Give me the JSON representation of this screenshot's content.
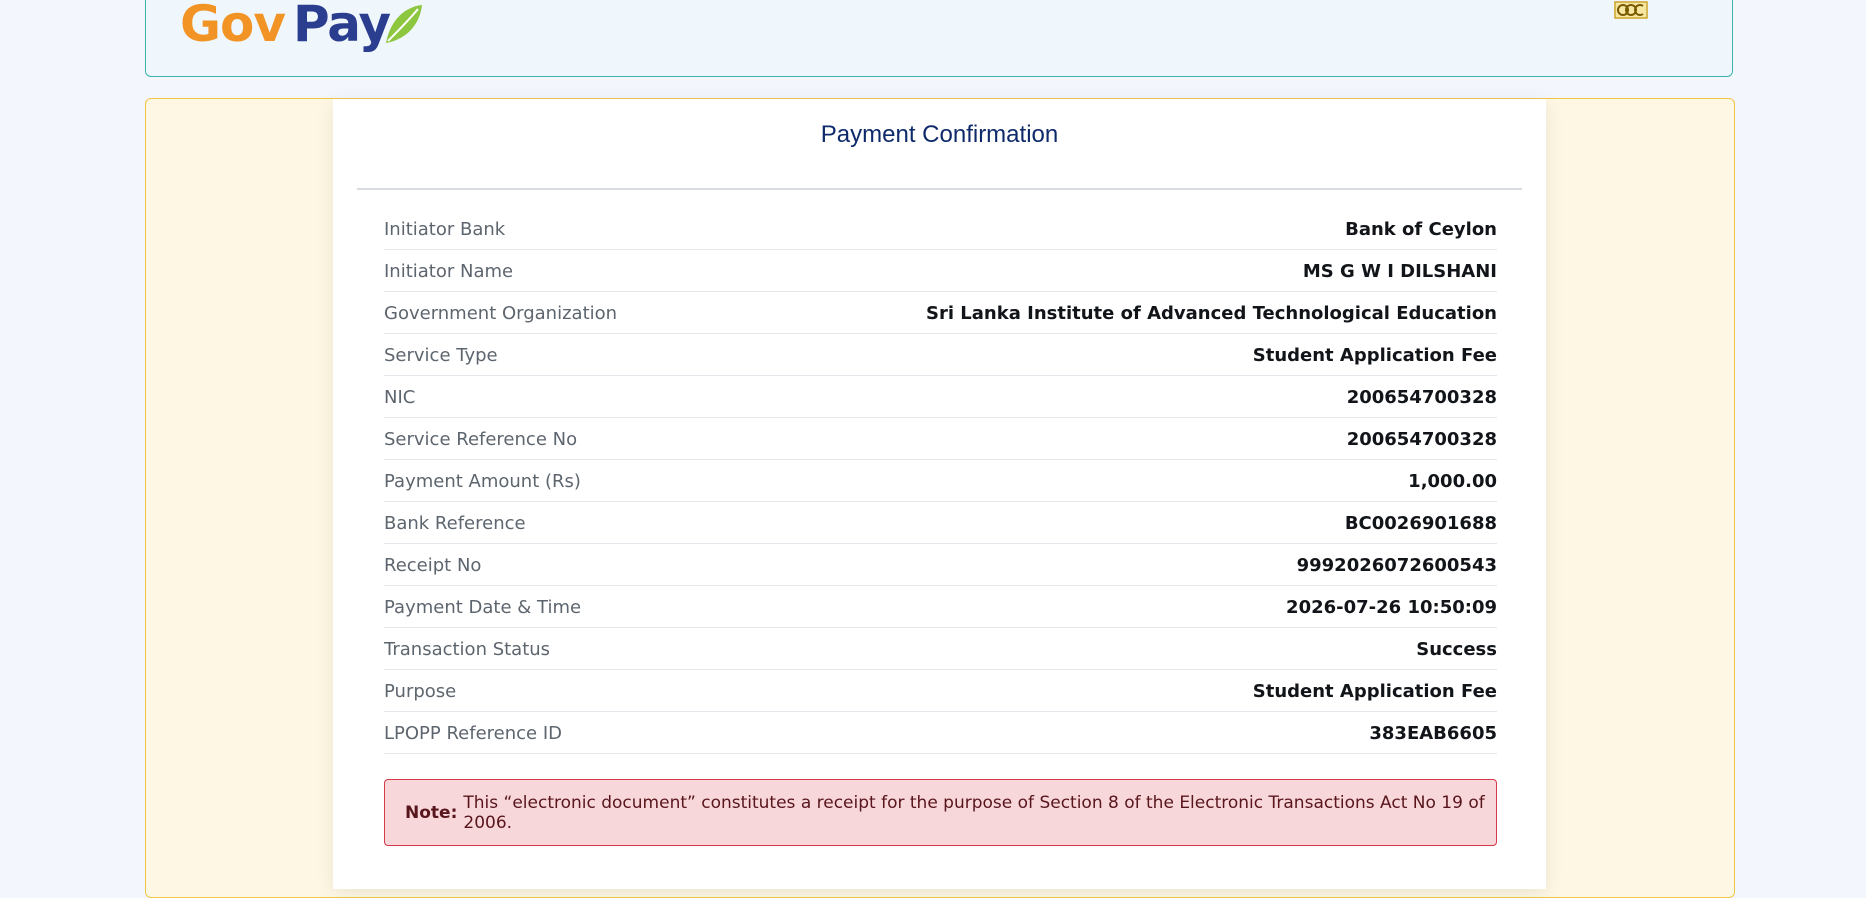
{
  "header": {
    "logo_gov": "Gov",
    "logo_pay": "Pay"
  },
  "card": {
    "title": "Payment Confirmation",
    "rows": [
      {
        "label": "Initiator Bank",
        "value": "Bank of Ceylon"
      },
      {
        "label": "Initiator Name",
        "value": "MS G W I DILSHANI"
      },
      {
        "label": "Government Organization",
        "value": "Sri Lanka Institute of Advanced Technological Education"
      },
      {
        "label": "Service Type",
        "value": "Student Application Fee"
      },
      {
        "label": "NIC",
        "value": "200654700328"
      },
      {
        "label": "Service Reference No",
        "value": "200654700328"
      },
      {
        "label": "Payment Amount (Rs)",
        "value": "1,000.00"
      },
      {
        "label": "Bank Reference",
        "value": "BC0026901688"
      },
      {
        "label": "Receipt No",
        "value": "9992026072600543"
      },
      {
        "label": "Payment Date & Time",
        "value": "2026-07-26 10:50:09"
      },
      {
        "label": "Transaction Status",
        "value": "Success"
      },
      {
        "label": "Purpose",
        "value": "Student Application Fee"
      },
      {
        "label": "LPOPP Reference ID",
        "value": "383EAB6605"
      }
    ]
  },
  "note": {
    "label": "Note:",
    "text": "This “electronic document” constitutes a receipt for the purpose of Section 8 of the Electronic Transactions Act No 19 of 2006."
  },
  "colors": {
    "page_bg": "#f3f6fc",
    "header_border": "#3cb3ae",
    "outer_bg": "#fdf7e3",
    "outer_border": "#f0c64a",
    "title": "#0e2a6b",
    "note_bg": "#f8d7da",
    "note_border": "#d43a48",
    "logo_orange": "#f29425",
    "logo_blue": "#2a3d8f"
  }
}
